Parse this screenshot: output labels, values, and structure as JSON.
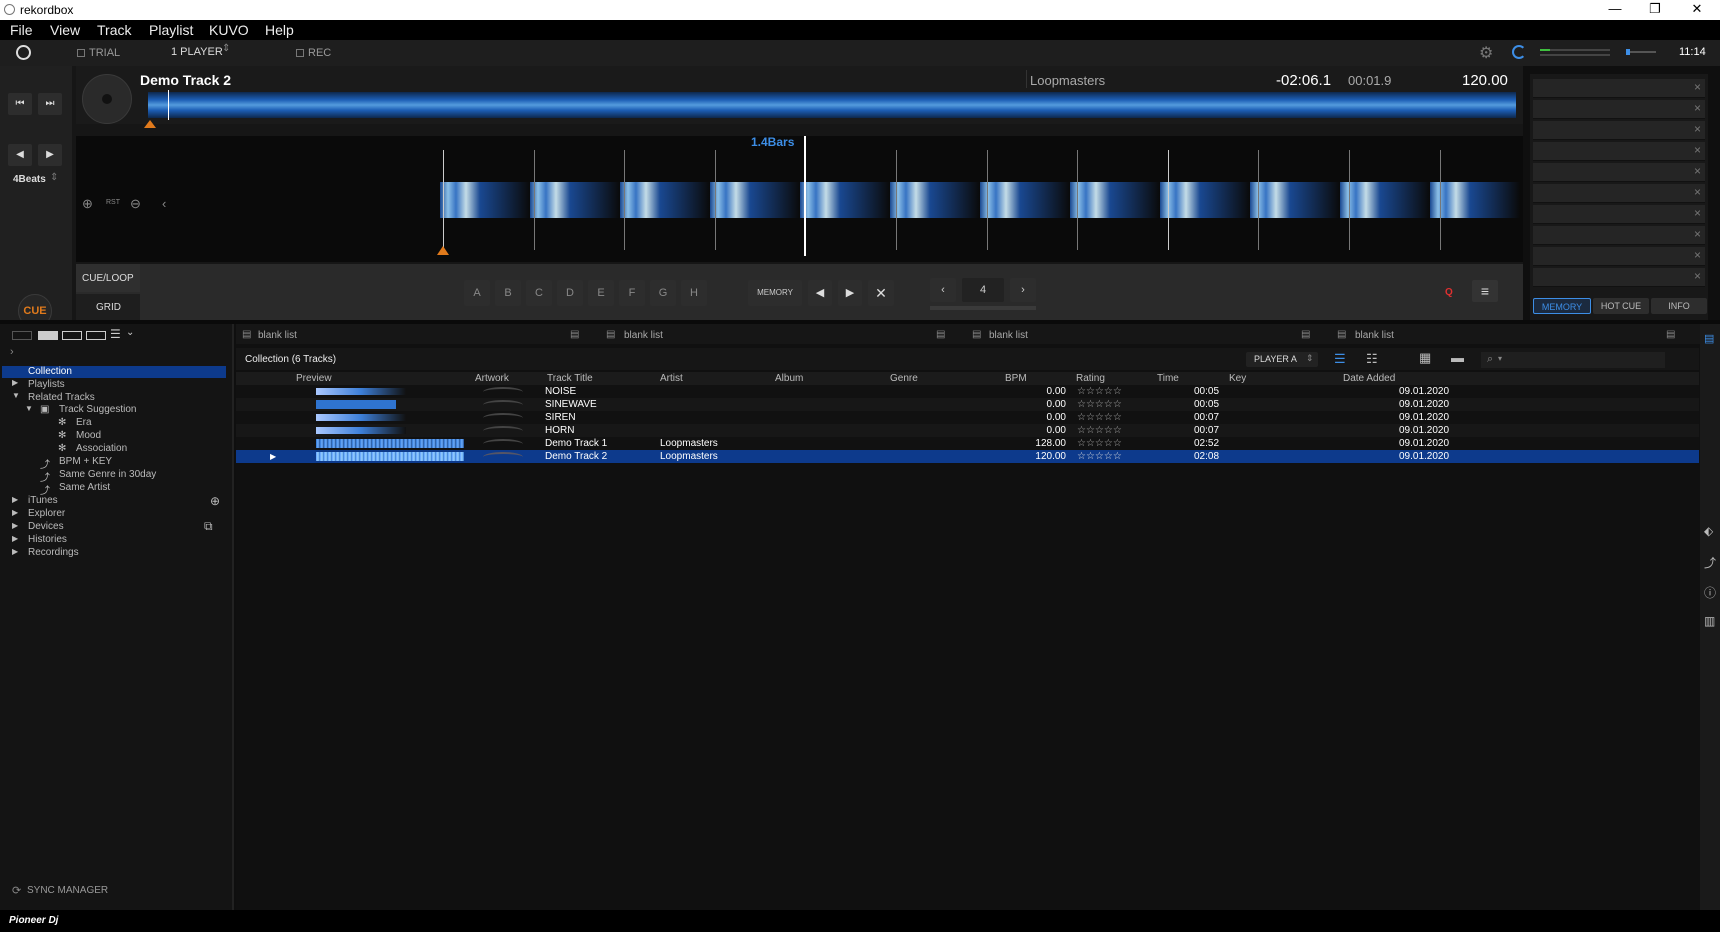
{
  "window": {
    "title": "rekordbox"
  },
  "menu": {
    "items": [
      "File",
      "View",
      "Track",
      "Playlist",
      "KUVO",
      "Help"
    ]
  },
  "toolbar": {
    "trial": "TRIAL",
    "players": "1 PLAYER",
    "rec": "REC",
    "clock": "11:14"
  },
  "deck": {
    "title": "Demo Track 2",
    "artist": "Loopmasters",
    "remaining": "-02:06.1",
    "elapsed": "00:01.9",
    "bpm": "120.00",
    "beats": "4Beats",
    "bars": "1.4Bars",
    "cue": "CUE",
    "cueloop": "CUE/LOOP",
    "grid": "GRID",
    "rst": "RST",
    "pads": [
      "A",
      "B",
      "C",
      "D",
      "E",
      "F",
      "G",
      "H"
    ],
    "memory": "MEMORY",
    "loop_value": "4",
    "q": "Q"
  },
  "rightpanel": {
    "tabs": [
      "MEMORY",
      "HOT CUE",
      "INFO"
    ],
    "close_glyph": "×"
  },
  "tree": {
    "items": [
      "Collection",
      "Playlists",
      "Related Tracks",
      "Track Suggestion",
      "Era",
      "Mood",
      "Association",
      "BPM + KEY",
      "Same Genre in 30day",
      "Same Artist",
      "iTunes",
      "Explorer",
      "Devices",
      "Histories",
      "Recordings"
    ],
    "sync": "SYNC MANAGER"
  },
  "tabs": [
    "blank list",
    "blank list",
    "blank list",
    "blank list"
  ],
  "collection": {
    "title": "Collection (6 Tracks)",
    "player": "PLAYER A",
    "columns": [
      "Preview",
      "Artwork",
      "Track Title",
      "Artist",
      "Album",
      "Genre",
      "BPM",
      "Rating",
      "Time",
      "Key",
      "Date Added"
    ],
    "rows": [
      {
        "title": "NOISE",
        "artist": "",
        "bpm": "0.00",
        "time": "00:05",
        "date": "09.01.2020"
      },
      {
        "title": "SINEWAVE",
        "artist": "",
        "bpm": "0.00",
        "time": "00:05",
        "date": "09.01.2020"
      },
      {
        "title": "SIREN",
        "artist": "",
        "bpm": "0.00",
        "time": "00:07",
        "date": "09.01.2020"
      },
      {
        "title": "HORN",
        "artist": "",
        "bpm": "0.00",
        "time": "00:07",
        "date": "09.01.2020"
      },
      {
        "title": "Demo Track 1",
        "artist": "Loopmasters",
        "bpm": "128.00",
        "time": "02:52",
        "date": "09.01.2020"
      },
      {
        "title": "Demo Track 2",
        "artist": "Loopmasters",
        "bpm": "120.00",
        "time": "02:08",
        "date": "09.01.2020"
      }
    ],
    "stars": "☆☆☆☆☆",
    "play_glyph": "▶"
  },
  "footer": {
    "brand": "Pioneer Dj"
  },
  "colors": {
    "accent": "#3d8ee6",
    "selected_row": "#0d3a8c",
    "cue_orange": "#e07a1c",
    "play_green": "#6fcf2a"
  }
}
